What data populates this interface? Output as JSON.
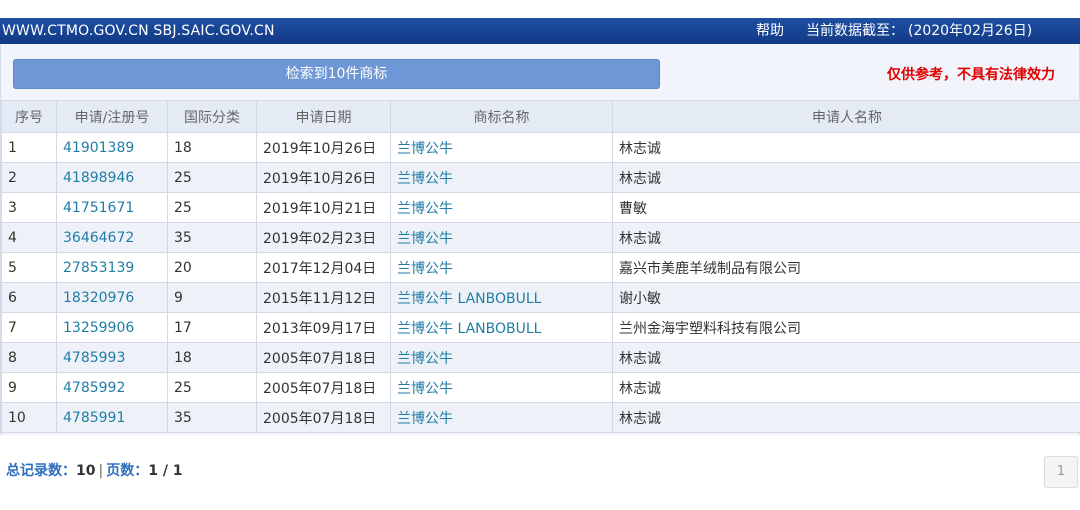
{
  "header": {
    "url": "WWW.CTMO.GOV.CN SBJ.SAIC.GOV.CN",
    "help": "帮助",
    "cutoff_label": "当前数据截至：",
    "cutoff_date": "(2020年02月26日)"
  },
  "result_summary": "检索到10件商标",
  "disclaimer": "仅供参考，不具有法律效力",
  "table": {
    "columns": [
      "序号",
      "申请/注册号",
      "国际分类",
      "申请日期",
      "商标名称",
      "申请人名称"
    ],
    "rows": [
      {
        "no": "1",
        "reg_no": "41901389",
        "class": "18",
        "date": "2019年10月26日",
        "name": "兰博公牛",
        "applicant": "林志诚"
      },
      {
        "no": "2",
        "reg_no": "41898946",
        "class": "25",
        "date": "2019年10月26日",
        "name": "兰博公牛",
        "applicant": "林志诚"
      },
      {
        "no": "3",
        "reg_no": "41751671",
        "class": "25",
        "date": "2019年10月21日",
        "name": "兰博公牛",
        "applicant": "曹敏"
      },
      {
        "no": "4",
        "reg_no": "36464672",
        "class": "35",
        "date": "2019年02月23日",
        "name": "兰博公牛",
        "applicant": "林志诚"
      },
      {
        "no": "5",
        "reg_no": "27853139",
        "class": "20",
        "date": "2017年12月04日",
        "name": "兰博公牛",
        "applicant": "嘉兴市美鹿羊绒制品有限公司"
      },
      {
        "no": "6",
        "reg_no": "18320976",
        "class": "9",
        "date": "2015年11月12日",
        "name": "兰博公牛 LANBOBULL",
        "applicant": "谢小敏"
      },
      {
        "no": "7",
        "reg_no": "13259906",
        "class": "17",
        "date": "2013年09月17日",
        "name": "兰博公牛 LANBOBULL",
        "applicant": "兰州金海宇塑料科技有限公司"
      },
      {
        "no": "8",
        "reg_no": "4785993",
        "class": "18",
        "date": "2005年07月18日",
        "name": "兰博公牛",
        "applicant": "林志诚"
      },
      {
        "no": "9",
        "reg_no": "4785992",
        "class": "25",
        "date": "2005年07月18日",
        "name": "兰博公牛",
        "applicant": "林志诚"
      },
      {
        "no": "10",
        "reg_no": "4785991",
        "class": "35",
        "date": "2005年07月18日",
        "name": "兰博公牛",
        "applicant": "林志诚"
      }
    ]
  },
  "footer": {
    "total_label": "总记录数：",
    "total_value": "10",
    "separator": "|",
    "pages_label": "页数：",
    "pages_value": "1 / 1",
    "page_button": "1"
  },
  "colors": {
    "header_bg": "#1f4fa3",
    "result_bar_bg": "#6f97d6",
    "disclaimer": "#e00000",
    "link": "#1f7ea6"
  }
}
